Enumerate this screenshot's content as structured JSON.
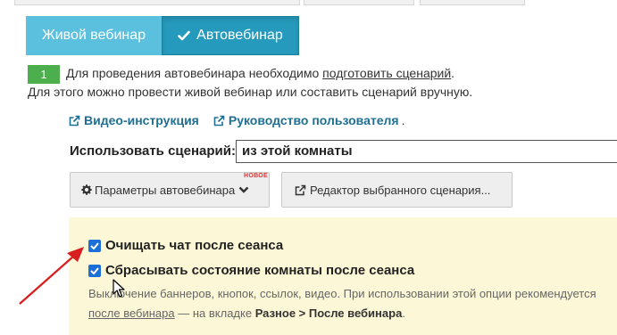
{
  "mode_buttons": {
    "live": "Живой вебинар",
    "auto": "Автовебинар"
  },
  "info": {
    "step": "1",
    "line1_prefix": "Для проведения автовебинара необходимо ",
    "line1_link": "подготовить сценарий",
    "line1_suffix": ".",
    "line2": "Для этого можно провести живой вебинар или составить сценарий вручную."
  },
  "links": {
    "video": "Видео-инструкция",
    "guide": "Руководство пользователя",
    "trailing": "."
  },
  "scenario": {
    "label": "Использовать сценарий:",
    "value": "из этой комнаты"
  },
  "toolbar": {
    "params_label": "Параметры автовебинара",
    "new_badge": "НОВОЕ",
    "editor_label": "Редактор выбранного сценария..."
  },
  "options": {
    "clear_chat": {
      "label": "Очищать чат после сеанса",
      "checked": true
    },
    "reset_room": {
      "label": "Сбрасывать состояние комнаты после сеанса",
      "checked": true
    },
    "note_line1": "Выключение баннеров, кнопок, ссылок, видео. При использовании этой опции рекомендуется",
    "note_link": "после вебинара",
    "note_mid": " — на вкладке ",
    "note_tab": "Разное > После вебинара",
    "note_end": "."
  },
  "colors": {
    "live_button": "#5bc0de",
    "auto_button": "#269abc",
    "step_badge": "#4cae4c",
    "link": "#1f6f93",
    "panel": "#fcf8d7",
    "checkbox": "#1d6fd8",
    "arrow": "#d81e1e"
  },
  "icons": {
    "auto": "check-icon",
    "external": "external-link-icon",
    "params": "gear-icon",
    "dropdown": "chevron-down-icon",
    "cursor": "mouse-cursor-icon"
  }
}
